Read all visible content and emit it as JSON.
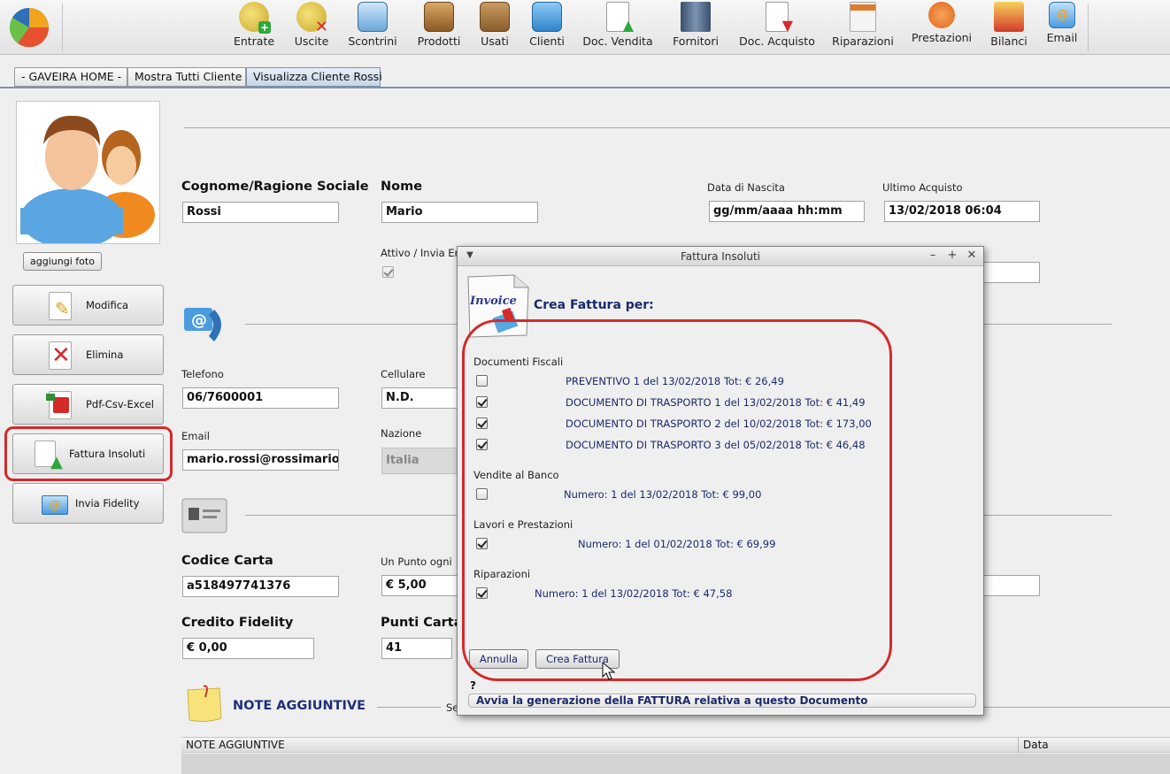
{
  "toolbar": {
    "items": [
      {
        "label": "Entrate",
        "icon": "coin-plus-icon"
      },
      {
        "label": "Uscite",
        "icon": "coin-minus-icon"
      },
      {
        "label": "Scontrini",
        "icon": "receipt-printer-icon"
      },
      {
        "label": "Prodotti",
        "icon": "boxes-icon"
      },
      {
        "label": "Usati",
        "icon": "open-box-icon"
      },
      {
        "label": "Clienti",
        "icon": "client-folder-icon"
      },
      {
        "label": "Doc. Vendita",
        "icon": "document-upload-icon"
      },
      {
        "label": "Fornitori",
        "icon": "building-icon"
      },
      {
        "label": "Doc. Acquisto",
        "icon": "document-download-icon"
      },
      {
        "label": "Riparazioni",
        "icon": "technical-doc-icon"
      },
      {
        "label": "Prestazioni",
        "icon": "service-icon"
      },
      {
        "label": "Bilanci",
        "icon": "balance-icon"
      },
      {
        "label": "Email",
        "icon": "email-icon"
      }
    ]
  },
  "tabs": [
    "- GAVEIRA HOME -",
    "Mostra Tutti Cliente",
    "Visualizza Cliente Rossi"
  ],
  "left": {
    "add_photo": "aggiungi foto",
    "buttons": [
      {
        "label": "Modifica",
        "icon": "pencil-document-icon"
      },
      {
        "label": "Elimina",
        "icon": "delete-x-icon"
      },
      {
        "label": "Pdf-Csv-Excel",
        "icon": "pdf-export-icon"
      },
      {
        "label": "Fattura Insoluti",
        "icon": "invoice-upload-icon"
      },
      {
        "label": "Invia Fidelity",
        "icon": "fidelity-mail-icon"
      }
    ]
  },
  "form": {
    "cognome_label": "Cognome/Ragione Sociale",
    "cognome_value": "Rossi",
    "nome_label": "Nome",
    "nome_value": "Mario",
    "data_nascita_label": "Data di Nascita",
    "data_nascita_value": "gg/mm/aaaa hh:mm",
    "ultimo_acquisto_label": "Ultimo Acquisto",
    "ultimo_acquisto_value": "13/02/2018 06:04",
    "attivo_label": "Attivo / Invia Er",
    "telefono_label": "Telefono",
    "telefono_value": "06/7600001",
    "cellulare_label": "Cellulare",
    "cellulare_value": "N.D.",
    "email_label": "Email",
    "email_value": "mario.rossi@rossimario",
    "nazione_label": "Nazione",
    "nazione_value": "Italia",
    "codice_carta_label": "Codice Carta",
    "codice_carta_value": "a518497741376",
    "punto_label": "Un Punto ogni",
    "punto_value": "€ 5,00",
    "credito_label": "Credito Fidelity",
    "credito_value": "€ 0,00",
    "punti_label": "Punti Carta",
    "punti_value": "41",
    "note_title": "NOTE AGGIUNTIVE",
    "note_se": "Se"
  },
  "notes_table": {
    "col1": "NOTE AGGIUNTIVE",
    "col2": "Data"
  },
  "dialog": {
    "title": "Fattura Insoluti",
    "invoice_icon_text": "Invoice",
    "heading": "Crea Fattura per:",
    "sections": [
      {
        "title": "Documenti Fiscali",
        "items": [
          {
            "text": "PREVENTIVO 1 del 13/02/2018 Tot: € 26,49",
            "checked": false
          },
          {
            "text": "DOCUMENTO DI TRASPORTO 1 del 13/02/2018 Tot: € 41,49",
            "checked": true
          },
          {
            "text": "DOCUMENTO DI TRASPORTO 2 del 10/02/2018 Tot: € 173,00",
            "checked": true
          },
          {
            "text": "DOCUMENTO DI TRASPORTO 3 del 05/02/2018 Tot: € 46,48",
            "checked": true
          }
        ]
      },
      {
        "title": "Vendite al Banco",
        "items": [
          {
            "text": "Numero: 1 del 13/02/2018 Tot: € 99,00",
            "checked": false
          }
        ]
      },
      {
        "title": "Lavori e Prestazioni",
        "items": [
          {
            "text": "Numero: 1 del 01/02/2018 Tot: € 69,99",
            "checked": true
          }
        ]
      },
      {
        "title": "Riparazioni",
        "items": [
          {
            "text": "Numero: 1 del 13/02/2018 Tot: € 47,58",
            "checked": true
          }
        ]
      }
    ],
    "cancel": "Annulla",
    "create": "Crea Fattura",
    "question": "?",
    "status": "Avvia la generazione della FATTURA relativa a questo Documento"
  }
}
